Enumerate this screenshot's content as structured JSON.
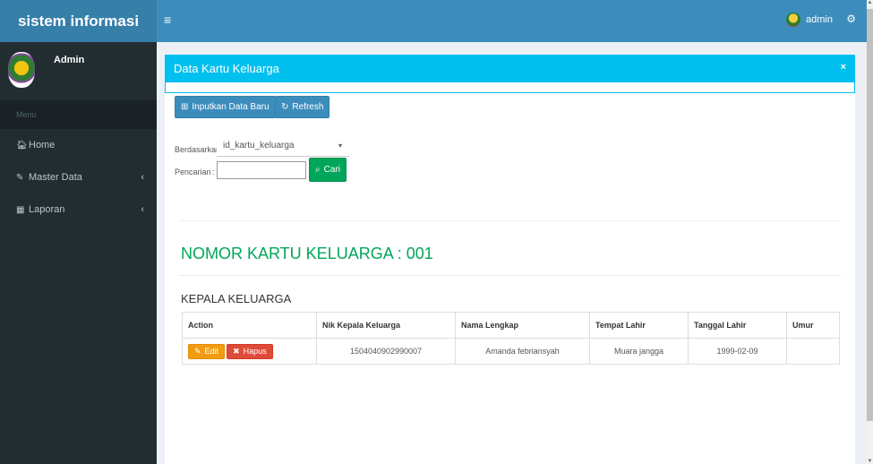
{
  "header": {
    "brand": "sistem informasi",
    "toggle_icon": "≡",
    "user_name": "admin",
    "settings_icon": "⚙"
  },
  "sidebar": {
    "user_name": "Admin",
    "menu_header": "Menu",
    "items": [
      {
        "label": "Home",
        "icon": "🏠︎",
        "chevron": ""
      },
      {
        "label": "Master Data",
        "icon": "✎",
        "chevron": "‹"
      },
      {
        "label": "Laporan",
        "icon": "▦",
        "chevron": "‹"
      }
    ]
  },
  "box": {
    "title": "Data Kartu Keluarga",
    "close_icon": "×"
  },
  "toolbar": {
    "new_label": "Inputkan Data Baru",
    "new_icon": "⊞",
    "refresh_label": "Refresh",
    "refresh_icon": "↻"
  },
  "filter": {
    "by_label": "Berdasarkan:",
    "by_value": "id_kartu_keluarga",
    "caret": "▾",
    "search_label": "Pencarian",
    "search_separator": ":",
    "search_value": "",
    "search_button": "Cari",
    "search_icon": "⌕"
  },
  "family": {
    "title": "NOMOR KARTU KELUARGA : 001",
    "subtitle": "KEPALA KELUARGA"
  },
  "table": {
    "headers": [
      "Action",
      "Nik Kepala Keluarga",
      "Nama Lengkap",
      "Tempat Lahir",
      "Tanggal Lahir",
      "Umur"
    ],
    "rows": [
      {
        "nik": "1504040902990007",
        "nama": "Amanda febriansyah",
        "tempat": "Muara jangga",
        "tanggal": "1999-02-09",
        "umur": "",
        "edit_label": "Edit",
        "edit_icon": "✎",
        "delete_label": "Hapus",
        "delete_icon": "✖"
      }
    ]
  },
  "colors": {
    "navbar": "#3c8dbc",
    "sidebar": "#222d32",
    "box_header": "#00c0ef",
    "success": "#00a65a",
    "warning": "#f39c12",
    "danger": "#dd4b39"
  }
}
